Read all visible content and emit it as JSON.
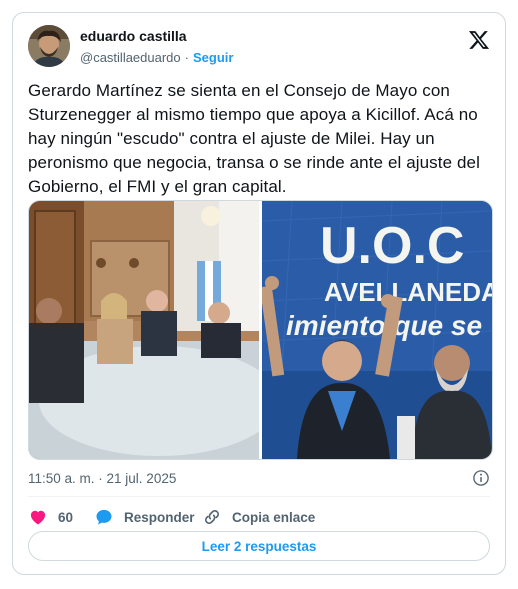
{
  "author": {
    "display_name": "eduardo castilla",
    "handle": "@castillaeduardo",
    "separator": "·",
    "follow_label": "Seguir"
  },
  "tweet": {
    "text": "Gerardo Martínez se sienta en el Consejo de Mayo con Sturzenegger al mismo tiempo que apoya a Kicillof. Acá no hay ningún \"escudo\" contra el ajuste de Milei. Hay un peronismo que negocia, transa o se rinde ante el ajuste del Gobierno, el FMI y el gran capital.",
    "timestamp": "11:50 a. m. · 21 jul. 2025"
  },
  "media": {
    "right_photo_sign": {
      "line1": "U.O.C",
      "line2": "AVELLANEDA",
      "line3": "imiento que se"
    }
  },
  "actions": {
    "like_count": "60",
    "reply_label": "Responder",
    "copy_label": "Copia enlace"
  },
  "more_replies_label": "Leer 2 respuestas",
  "colors": {
    "accent": "#1d9bf0",
    "like": "#f91880",
    "muted": "#536471",
    "border": "#cfd9de"
  },
  "icons": [
    "x-logo-icon",
    "info-icon",
    "heart-icon",
    "reply-bubble-icon",
    "link-icon"
  ]
}
